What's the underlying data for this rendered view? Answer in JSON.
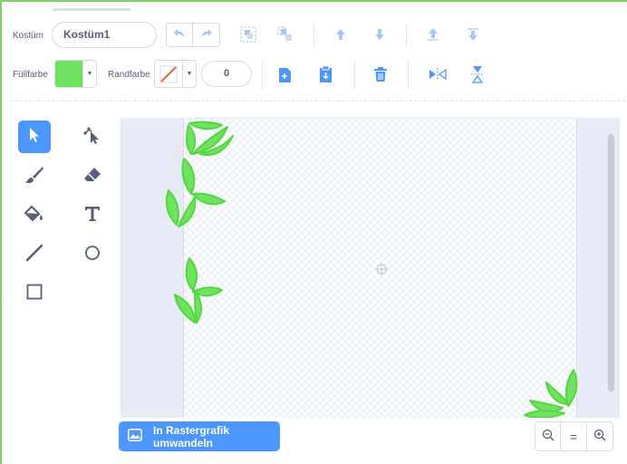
{
  "header": {
    "costume_label": "Kostüm",
    "costume_name": "Kostüm1"
  },
  "fill": {
    "label": "Füllfarbe",
    "color": "#6fe25f"
  },
  "outline": {
    "label": "Randfarbe",
    "width_value": "0"
  },
  "toolbar": {
    "buttons": [
      "undo-icon",
      "redo-icon",
      "group-icon",
      "ungroup-icon",
      "forward-icon",
      "backward-icon",
      "front-icon",
      "back-icon",
      "copy-icon",
      "paste-icon",
      "delete-icon",
      "flip-horizontal-icon",
      "flip-vertical-icon"
    ]
  },
  "tools": [
    "select-icon",
    "reshape-icon",
    "brush-icon",
    "eraser-icon",
    "fill-icon",
    "text-icon",
    "line-icon",
    "circle-icon",
    "rectangle-icon"
  ],
  "convert": {
    "label": "In Rastergrafik umwandeln"
  },
  "zoom": {
    "out": "−",
    "reset": "=",
    "in": "+"
  },
  "colors": {
    "accent": "#4c97ff",
    "icon_gray": "#575e75",
    "light_icon": "#a8c7f0",
    "leaf_green": "#6fe25f",
    "outline_red": "#e8693f"
  }
}
